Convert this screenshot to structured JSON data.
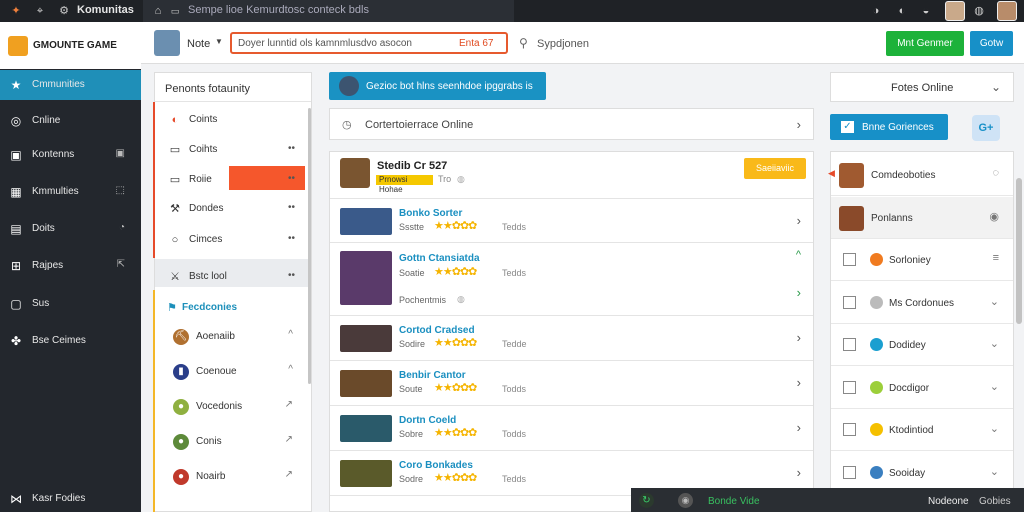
{
  "topbar": {
    "app_name": "Komunitas",
    "tab_title": "Sempe lioe Kemurdtosc conteck bdls"
  },
  "sidebar": {
    "logo_text": "GMOUNTE GAME",
    "items": [
      {
        "label": "Cmmunities",
        "icon": "star-icon",
        "glyph": "★",
        "right": ""
      },
      {
        "label": "Cnline",
        "icon": "target-icon",
        "glyph": "◎",
        "right": ""
      },
      {
        "label": "Kontenns",
        "icon": "monitor-icon",
        "glyph": "▣",
        "right": "▣"
      },
      {
        "label": "Kmmulties",
        "icon": "grid-icon",
        "glyph": "▦",
        "right": "⬚"
      },
      {
        "label": "Doits",
        "icon": "card-icon",
        "glyph": "▤",
        "right": "◔"
      },
      {
        "label": "Rajpes",
        "icon": "gift-icon",
        "glyph": "⊞",
        "right": "⇱"
      },
      {
        "label": "Sus",
        "icon": "frame-icon",
        "glyph": "▢",
        "right": ""
      },
      {
        "label": "Bse Ceimes",
        "icon": "puzzle-icon",
        "glyph": "✤",
        "right": ""
      },
      {
        "label": "Kasr Fodies",
        "icon": "share-icon",
        "glyph": "⋈",
        "right": ""
      }
    ]
  },
  "header": {
    "user_name": "Note",
    "search_value": "Doyer lunntid ols kamnmlusdvo asocon",
    "search_highlight": "Enta 67",
    "suggest_label": "Sypdjonen",
    "btn_primary": "Mnt Genmer",
    "btn_secondary": "Gotw"
  },
  "categories": {
    "title": "Penonts fotaunity",
    "items": [
      {
        "label": "Coints",
        "icon": "swirl-icon",
        "glyph": "◐",
        "right": ""
      },
      {
        "label": "Coihts",
        "icon": "chat-icon",
        "glyph": "▭",
        "right": "••"
      },
      {
        "label": "Roiie",
        "icon": "tv-icon",
        "glyph": "▭",
        "right": "••"
      },
      {
        "label": "Dondes",
        "icon": "tools-icon",
        "glyph": "⚒",
        "right": "••"
      },
      {
        "label": "Cimces",
        "icon": "circle-icon",
        "glyph": "○",
        "right": "••"
      },
      {
        "label": "Bstc lool",
        "icon": "swords-icon",
        "glyph": "⚔",
        "right": "••"
      }
    ],
    "featured_label": "Fecdconies",
    "sub_items": [
      {
        "label": "Aoenaiib",
        "icon": "axe-icon",
        "glyph": "⛏",
        "color": "#b07030",
        "right": "^"
      },
      {
        "label": "Coenoue",
        "icon": "banner-icon",
        "glyph": "▮",
        "color": "#2a3e8a",
        "right": "^"
      },
      {
        "label": "Vocedonis",
        "icon": "globe-icon",
        "glyph": "●",
        "color": "#8fb040",
        "right": "↗"
      },
      {
        "label": "Conis",
        "icon": "orb-icon",
        "glyph": "●",
        "color": "#5d8a3a",
        "right": "↗"
      },
      {
        "label": "Noairb",
        "icon": "shield-icon",
        "glyph": "●",
        "color": "#c0392b",
        "right": "↗"
      }
    ]
  },
  "center": {
    "banner_text": "Gezioc bot hlns seenhdoe ipggrabs is",
    "online_label": "Cortertoierrace Online",
    "pinned": {
      "title": "Stedib Cr 527",
      "badge": "Prnowsi Hohae",
      "tag": "Tro"
    },
    "pinned_note": "Saeiiaviic",
    "games": [
      {
        "title": "Bonko Sorter",
        "meta": "Ssstte",
        "tag": "Tedds",
        "thumb": "#3a5a8a"
      },
      {
        "title": "Gottn Ctansiatda",
        "meta": "Soatie",
        "tag": "Tedds",
        "thumb": "#5a3a6a"
      },
      {
        "title": "Cortod Cradsed",
        "meta": "Sodire",
        "tag": "Tedde",
        "thumb": "#4a3a3a"
      },
      {
        "title": "Benbir Cantor",
        "meta": "Soute",
        "tag": "Todds",
        "thumb": "#6a4a2a"
      },
      {
        "title": "Dortn Coeld",
        "meta": "Sobre",
        "tag": "Todds",
        "thumb": "#2a5a6a"
      },
      {
        "title": "Coro Bonkades",
        "meta": "Sodre",
        "tag": "Tedds",
        "thumb": "#5a5a2a"
      }
    ],
    "tall_row_sub": "Pochentmis"
  },
  "right_panel": {
    "select_label": "Fotes Online",
    "btn_label": "Bnne Goriences",
    "g_icon_label": "G+",
    "rows": [
      {
        "label": "Comdeoboties",
        "kind": "img",
        "color": "#a05a30",
        "right": "◌"
      },
      {
        "label": "Ponlanns",
        "kind": "img",
        "color": "#8a4a2a",
        "right": "◉"
      },
      {
        "label": "Sorloniey",
        "kind": "dot",
        "color": "#f07b20",
        "right": "≡"
      },
      {
        "label": "Ms Cordonues",
        "kind": "dot",
        "color": "#bbbbbb",
        "right": "⌄"
      },
      {
        "label": "Dodidey",
        "kind": "dot",
        "color": "#1a9fd0",
        "right": "⌄"
      },
      {
        "label": "Docdigor",
        "kind": "dot",
        "color": "#9ccf3a",
        "right": "⌄"
      },
      {
        "label": "Ktodintiod",
        "kind": "dot",
        "color": "#f5c000",
        "right": "⌄"
      },
      {
        "label": "Sooiday",
        "kind": "dot",
        "color": "#3a7fc0",
        "right": "⌄"
      }
    ]
  },
  "footer_popup": {
    "label1": "Bonde Vide",
    "label2": "Nodeone",
    "label3": "Gobies"
  },
  "colors": {
    "accent_blue": "#1a92c3",
    "accent_orange": "#f5572c",
    "accent_green": "#1db23a"
  }
}
